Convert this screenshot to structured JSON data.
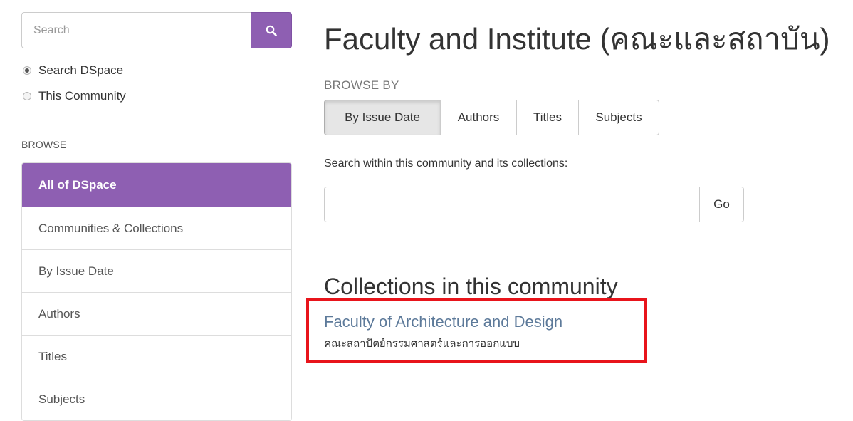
{
  "search": {
    "placeholder": "Search",
    "button_icon": "search-icon",
    "scope_options": [
      {
        "label": "Search DSpace",
        "selected": true
      },
      {
        "label": "This Community",
        "selected": false
      }
    ]
  },
  "browse": {
    "heading": "BROWSE",
    "items": [
      {
        "label": "All of DSpace",
        "active": true
      },
      {
        "label": "Communities & Collections",
        "active": false
      },
      {
        "label": "By Issue Date",
        "active": false
      },
      {
        "label": "Authors",
        "active": false
      },
      {
        "label": "Titles",
        "active": false
      },
      {
        "label": "Subjects",
        "active": false
      }
    ]
  },
  "main": {
    "title": "Faculty and Institute (คณะและสถาบัน)",
    "browse_by": {
      "label": "BROWSE BY",
      "buttons": [
        {
          "label": "By Issue Date",
          "active": true
        },
        {
          "label": "Authors",
          "active": false
        },
        {
          "label": "Titles",
          "active": false
        },
        {
          "label": "Subjects",
          "active": false
        }
      ]
    },
    "search_within": {
      "label": "Search within this community and its collections:",
      "value": "",
      "go_label": "Go"
    },
    "collections": {
      "heading": "Collections in this community",
      "items": [
        {
          "title": "Faculty of Architecture and Design",
          "description": "คณะสถาปัตย์กรรมศาสตร์และการออกแบบ"
        }
      ]
    }
  },
  "colors": {
    "accent": "#8e5fb2",
    "link": "#5d7a9a",
    "highlight": "#e8141b"
  }
}
